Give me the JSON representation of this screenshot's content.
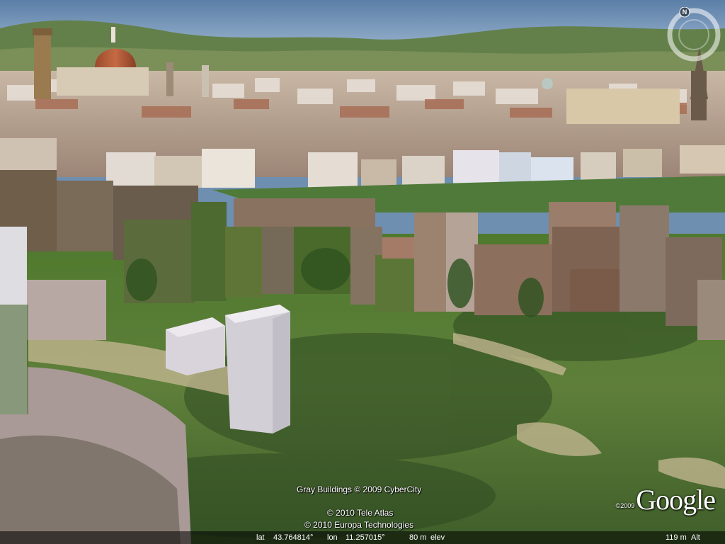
{
  "app": {
    "name": "Google Earth 3D view"
  },
  "attributions": {
    "buildings": "Gray Buildings © 2009 CyberCity",
    "imagery_1": "© 2010 Tele Atlas",
    "imagery_2": "© 2010 Europa Technologies"
  },
  "logo": {
    "year": "©2009",
    "text": "Google"
  },
  "navigation": {
    "compass_north_label": "N",
    "icon": "compass-ring-icon"
  },
  "status": {
    "lat_label": "lat",
    "lat_value": "43.764814°",
    "lon_label": "lon",
    "lon_value": "11.257015°",
    "elev_value": "80 m",
    "elev_label": "elev",
    "alt_value": "119 m",
    "alt_label": "Alt"
  },
  "colors": {
    "sky": "#7e9cbf",
    "hills": "#5f7a45",
    "lawn": "#5d7f36",
    "roofs": "#b89278",
    "gray_buildings": "#d6d3da",
    "status_bar_bg": "#000000"
  }
}
